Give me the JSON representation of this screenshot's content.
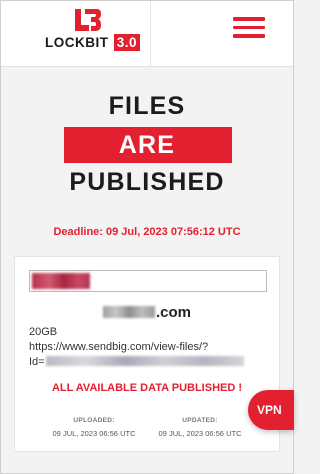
{
  "header": {
    "logo_text": "LOCKBIT",
    "logo_version": "3.0",
    "menu_icon": "hamburger-menu-icon",
    "accent_color": "#e2202f"
  },
  "title": {
    "line1": "FILES",
    "line2": "ARE",
    "line3": "PUBLISHED"
  },
  "deadline": "Deadline: 09 Jul, 2023 07:56:12 UTC",
  "post": {
    "domain_suffix": ".com",
    "size": "20GB",
    "link_line1": "https://www.sendbig.com/view-files/?",
    "link_line2_prefix": "Id=",
    "status": "ALL AVAILABLE DATA PUBLISHED !",
    "uploaded_label": "UPLOADED:",
    "uploaded_value": "09 JUL, 2023 06:56 UTC",
    "updated_label": "UPDATED:",
    "updated_value": "09 JUL, 2023 06:56 UTC"
  },
  "vpn_button": "VPN"
}
